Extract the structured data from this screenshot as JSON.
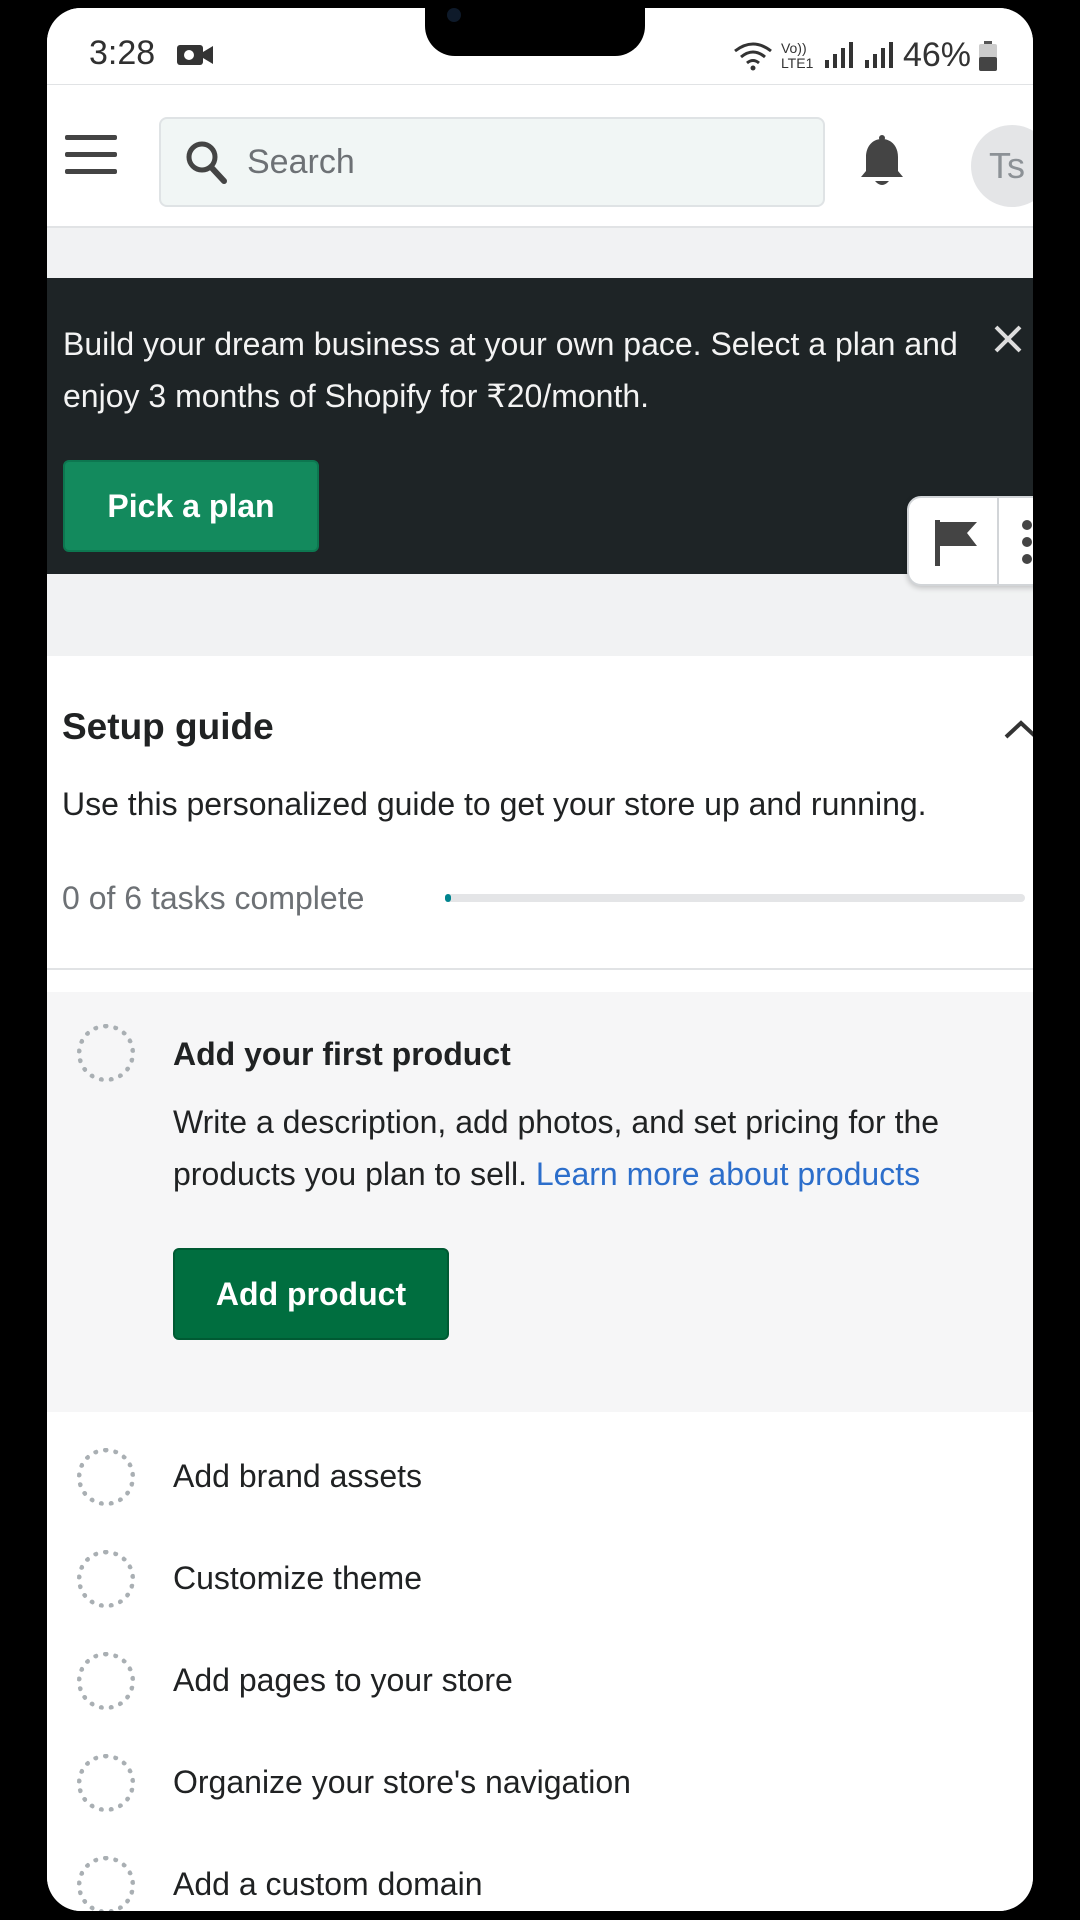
{
  "status_bar": {
    "time": "3:28",
    "network": "Vo)) LTE1",
    "battery": "46%"
  },
  "topbar": {
    "search_placeholder": "Search",
    "avatar_initials": "Ts"
  },
  "banner": {
    "text": "Build your dream business at your own pace. Select a plan and enjoy 3 months of Shopify for ₹20/month.",
    "button": "Pick a plan"
  },
  "setup_guide": {
    "title": "Setup guide",
    "description": "Use this personalized guide to get your store up and running.",
    "progress_label": "0 of 6 tasks complete",
    "progress_fraction": 0.0,
    "active_task": {
      "title": "Add your first product",
      "description": "Write a description, add photos, and set pricing for the products you plan to sell.",
      "link": "Learn more about products",
      "button": "Add product"
    },
    "tasks": [
      "Add brand assets",
      "Customize theme",
      "Add pages to your store",
      "Organize your store's navigation",
      "Add a custom domain"
    ]
  },
  "colors": {
    "banner_bg": "#1e2426",
    "primary_green": "#006e3f",
    "banner_button": "#138a5d",
    "link": "#2c6ecb"
  },
  "icons": [
    "menu-icon",
    "search-icon",
    "bell-icon",
    "close-icon",
    "flag-icon",
    "more-vertical-icon",
    "chevron-up-icon",
    "dashed-circle-icon"
  ]
}
